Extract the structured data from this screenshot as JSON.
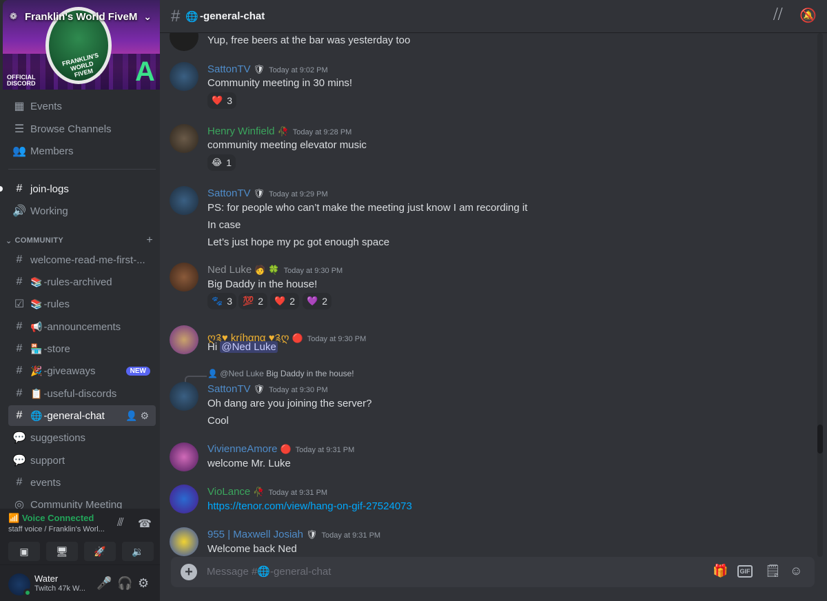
{
  "server": {
    "name": "Franklin's World FiveM",
    "banner_logo_text": "FRANKLIN'S WORLD FIVEM",
    "banner_official": "OFFICIAL",
    "banner_discord": "DISCORD"
  },
  "sidebar": {
    "top_items": [
      {
        "label": "Events",
        "icon": "calendar-icon"
      },
      {
        "label": "Browse Channels",
        "icon": "browse-icon"
      },
      {
        "label": "Members",
        "icon": "members-icon"
      }
    ],
    "channels": [
      {
        "label": "join-logs",
        "icon": "hash-icon"
      },
      {
        "label": "Working",
        "icon": "voice-icon"
      }
    ],
    "category": "COMMUNITY",
    "community_channels": [
      {
        "label": "welcome-read-me-first-...",
        "emoji": ""
      },
      {
        "label": "-rules-archived",
        "emoji": "📚"
      },
      {
        "label": "-rules",
        "emoji": "📚"
      },
      {
        "label": "-announcements",
        "emoji": "📢"
      },
      {
        "label": "-store",
        "emoji": "🏪"
      },
      {
        "label": "-giveaways",
        "emoji": "🎉",
        "badge": "NEW"
      },
      {
        "label": "-useful-discords",
        "emoji": "📋"
      },
      {
        "label": "-general-chat",
        "emoji": "🌐"
      },
      {
        "label": "suggestions",
        "emoji": ""
      },
      {
        "label": "support",
        "emoji": ""
      },
      {
        "label": "events",
        "emoji": ""
      },
      {
        "label": "Community Meeting",
        "emoji": ""
      }
    ]
  },
  "voice": {
    "status": "Voice Connected",
    "channel": "staff voice / Franklin's Worl..."
  },
  "user": {
    "name": "Water",
    "status": "Twitch 47k W..."
  },
  "channel": {
    "name": "-general-chat",
    "placeholder": "Message #🌐-general-chat"
  },
  "messages": [
    {
      "author": "",
      "time": "",
      "lines": [
        "Yup, free beers at the bar was yesterday too"
      ]
    },
    {
      "author": "SattonTV",
      "time": "Today at 9:02 PM",
      "lines": [
        "Community meeting in 30 mins!"
      ],
      "reactions": [
        {
          "emoji": "❤️",
          "count": "3"
        }
      ]
    },
    {
      "author": "Henry Winfield",
      "time": "Today at 9:28 PM",
      "lines": [
        "community meeting elevator music"
      ],
      "reactions": [
        {
          "emoji": "😂",
          "count": "1"
        }
      ]
    },
    {
      "author": "SattonTV",
      "time": "Today at 9:29 PM",
      "lines": [
        "PS: for people who can’t make the meeting just know I am recording it",
        "In case",
        "Let’s just hope my pc got enough space"
      ]
    },
    {
      "author": "Ned Luke",
      "time": "Today at 9:30 PM",
      "lines": [
        "Big Daddy in the house!"
      ],
      "reactions": [
        {
          "emoji": "🐾",
          "count": "3"
        },
        {
          "emoji": "💯",
          "count": "2"
        },
        {
          "emoji": "❤️",
          "count": "2"
        },
        {
          "emoji": "💜",
          "count": "2"
        }
      ]
    },
    {
      "author": "ღ༉♥ kríhαηα ♥༉ღ",
      "time": "Today at 9:30 PM",
      "lines": [
        "Hi"
      ],
      "mention": "@Ned Luke"
    },
    {
      "author": "SattonTV",
      "time": "Today at 9:30 PM",
      "reply_to": "@Ned Luke",
      "reply_text": "Big Daddy in the house!",
      "lines": [
        "Oh dang are you joining the server?",
        "Cool"
      ]
    },
    {
      "author": "VivienneAmore",
      "time": "Today at 9:31 PM",
      "lines": [
        "welcome Mr. Luke"
      ]
    },
    {
      "author": "VioLance",
      "time": "Today at 9:31 PM",
      "lines": [
        "https://tenor.com/view/hang-on-gif-27524073"
      ]
    },
    {
      "author": "955 | Maxwell Josiah",
      "time": "Today at 9:31 PM",
      "lines": [
        "Welcome back Ned"
      ]
    }
  ],
  "colors": {
    "accent": "#5865f2",
    "online": "#23a55a",
    "link": "#00a8fc",
    "author_blue": "#4f8cc9",
    "author_green": "#3ba55d",
    "author_gray": "#8e9297",
    "author_gold": "#f0b232"
  }
}
